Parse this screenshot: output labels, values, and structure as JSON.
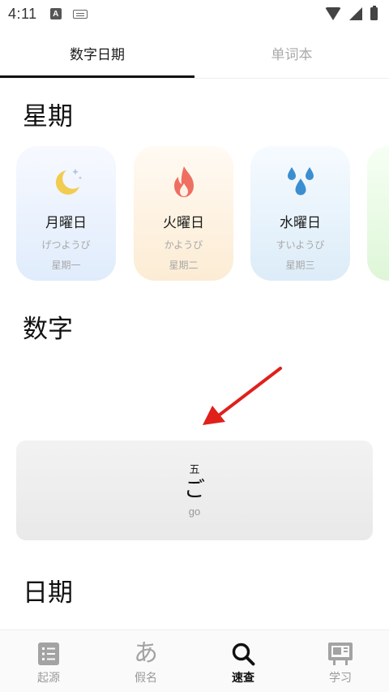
{
  "status_bar": {
    "time": "4:11",
    "notification_letter": "A"
  },
  "tabs": [
    {
      "label": "数字日期",
      "active": true
    },
    {
      "label": "单词本",
      "active": false
    }
  ],
  "sections": {
    "weekdays_title": "星期",
    "numbers_title": "数字",
    "dates_title": "日期"
  },
  "weekdays": [
    {
      "icon": "moon-icon",
      "japanese": "月曜日",
      "kana": "げつようび",
      "chinese": "星期一",
      "color": "#f2cc50"
    },
    {
      "icon": "fire-icon",
      "japanese": "火曜日",
      "kana": "かようび",
      "chinese": "星期二",
      "color": "#ee6f61"
    },
    {
      "icon": "water-drops-icon",
      "japanese": "水曜日",
      "kana": "すいようび",
      "chinese": "星期三",
      "color": "#3b8fd0"
    }
  ],
  "number_card": {
    "kanji": "五",
    "kana": "ご",
    "romaji": "go"
  },
  "annotation_color": "#e0201b",
  "bottom_nav": [
    {
      "icon": "list-icon",
      "label": "起源",
      "active": false
    },
    {
      "icon": "hiragana-a-icon",
      "glyph": "あ",
      "label": "假名",
      "active": false
    },
    {
      "icon": "search-icon",
      "label": "速查",
      "active": true
    },
    {
      "icon": "study-board-icon",
      "label": "学习",
      "active": false
    }
  ]
}
